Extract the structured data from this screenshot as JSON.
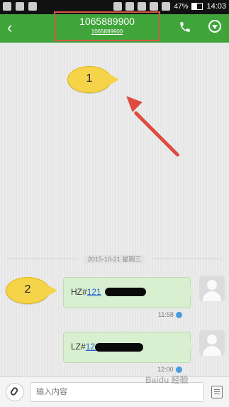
{
  "status_bar": {
    "battery": "47%",
    "time": "14:03"
  },
  "header": {
    "back_icon": "‹",
    "title": "1065889900",
    "subtitle": "1065889900",
    "call_icon": "phone-icon",
    "menu_icon": "chevron-down-circle-icon",
    "accent_color": "#3fa53a",
    "highlight_color": "#d9554b"
  },
  "annotations": {
    "callout_1": "1",
    "callout_2": "2",
    "arrow_color": "#e04b3f"
  },
  "chat": {
    "date_separator": "2015-10-21 星期三",
    "messages": [
      {
        "prefix": "HZ#",
        "link_text": "121",
        "time": "11:58"
      },
      {
        "prefix": "LZ#",
        "link_text": "121",
        "time": "12:00"
      }
    ]
  },
  "composer": {
    "placeholder": "输入内容"
  },
  "watermark": "Baidu 经验"
}
